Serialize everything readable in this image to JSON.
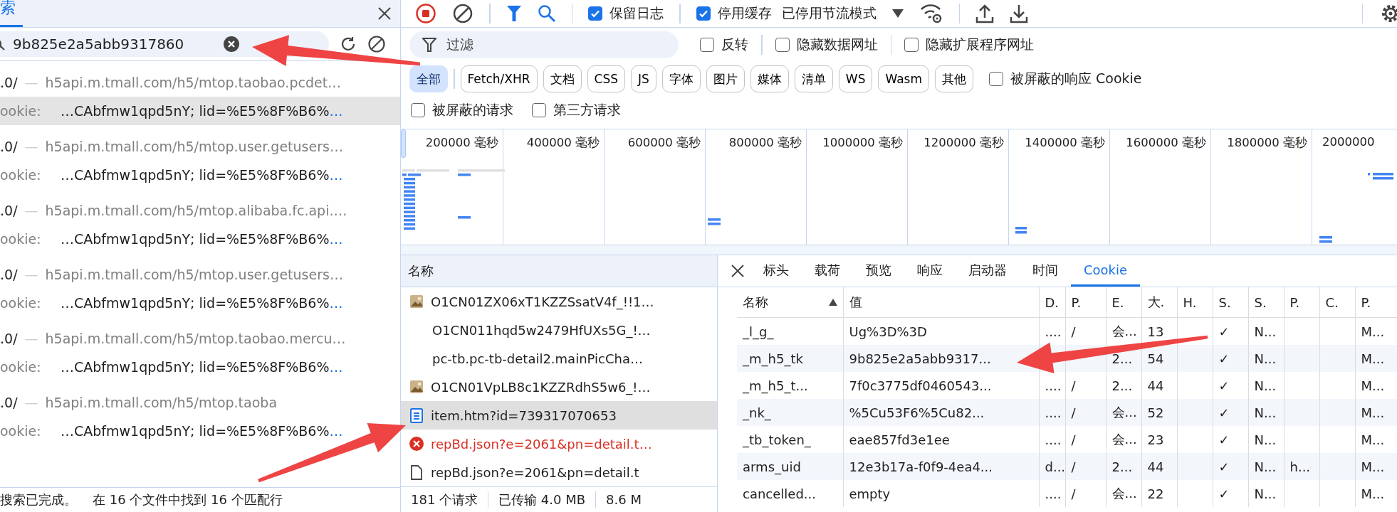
{
  "search_panel": {
    "tab": {
      "label": "索",
      "selected": true
    },
    "query": "9b825e2a5abb9317860",
    "results": [
      {
        "file": ".0/",
        "separator": "—",
        "url": "h5api.m.tmall.com/h5/mtop.taobao.pcdet…",
        "match_label": "ookie:",
        "match_text": "…CAbfmw1qpd5nY; lid=%E5%8F%B6%",
        "more": "…",
        "selected": true
      },
      {
        "file": ".0/",
        "separator": "—",
        "url": "h5api.m.tmall.com/h5/mtop.user.getusers…",
        "match_label": "ookie:",
        "match_text": "…CAbfmw1qpd5nY; lid=%E5%8F%B6%",
        "more": "…",
        "selected": false
      },
      {
        "file": ".0/",
        "separator": "—",
        "url": "h5api.m.tmall.com/h5/mtop.alibaba.fc.api.…",
        "match_label": "ookie:",
        "match_text": "…CAbfmw1qpd5nY; lid=%E5%8F%B6%",
        "more": "…",
        "selected": false
      },
      {
        "file": ".0/",
        "separator": "—",
        "url": "h5api.m.tmall.com/h5/mtop.user.getusers…",
        "match_label": "ookie:",
        "match_text": "…CAbfmw1qpd5nY; lid=%E5%8F%B6%",
        "more": "…",
        "selected": false
      },
      {
        "file": ".0/",
        "separator": "—",
        "url": "h5api.m.tmall.com/h5/mtop.taobao.mercu…",
        "match_label": "ookie:",
        "match_text": "…CAbfmw1qpd5nY; lid=%E5%8F%B6%",
        "more": "…",
        "selected": false
      },
      {
        "file": ".0/",
        "separator": "—",
        "url": "h5api.m.tmall.com/h5/mtop.taoba",
        "match_label": "ookie:",
        "match_text": "…CAbfmw1qpd5nY; lid=%E5%8F%B6%",
        "more": "…",
        "selected": false
      }
    ],
    "status": [
      "搜索已完成。",
      "在 16 个文件中找到 16 个匹配行"
    ]
  },
  "toolbar": {
    "recording": true,
    "filter_shown": true,
    "checkboxes": [
      {
        "label": "保留日志",
        "checked": true
      },
      {
        "label": "停用缓存",
        "checked": true
      }
    ],
    "throttling": "已停用节流模式"
  },
  "filters": {
    "placeholder": "过滤",
    "options": [
      {
        "label": "反转",
        "checked": false
      },
      {
        "label": "隐藏数据网址",
        "checked": false
      },
      {
        "label": "隐藏扩展程序网址",
        "checked": false
      }
    ],
    "types": [
      {
        "label": "全部",
        "selected": true
      },
      {
        "label": "Fetch/XHR",
        "selected": false
      },
      {
        "label": "文档",
        "selected": false
      },
      {
        "label": "CSS",
        "selected": false
      },
      {
        "label": "JS",
        "selected": false
      },
      {
        "label": "字体",
        "selected": false
      },
      {
        "label": "图片",
        "selected": false
      },
      {
        "label": "媒体",
        "selected": false
      },
      {
        "label": "清单",
        "selected": false
      },
      {
        "label": "WS",
        "selected": false
      },
      {
        "label": "Wasm",
        "selected": false
      },
      {
        "label": "其他",
        "selected": false
      }
    ],
    "blocked_cookies": {
      "label": "被屏蔽的响应 Cookie",
      "checked": false
    },
    "more_options": [
      {
        "label": "被屏蔽的请求",
        "checked": false
      },
      {
        "label": "第三方请求",
        "checked": false
      }
    ]
  },
  "overview": {
    "ticks": [
      "200000 毫秒",
      "400000 毫秒",
      "600000 毫秒",
      "800000 毫秒",
      "1000000 毫秒",
      "1200000 毫秒",
      "1400000 毫秒",
      "1600000 毫秒",
      "1800000 毫秒",
      "2000000"
    ]
  },
  "requests": {
    "header": "名称",
    "rows": [
      {
        "name": "O1CN01ZX06xT1KZZSsatV4f_!!1…",
        "kind": "image",
        "selected": false
      },
      {
        "name": "O1CN011hqd5w2479HfUXs5G_!…",
        "kind": "plain",
        "selected": false
      },
      {
        "name": "pc-tb.pc-tb-detail2.mainPicCha…",
        "kind": "plain",
        "selected": false
      },
      {
        "name": "O1CN01VpLB8c1KZZRdhS5w6_!…",
        "kind": "image",
        "selected": false
      },
      {
        "name": "item.htm?id=739317070653",
        "kind": "document",
        "selected": true
      },
      {
        "name": "repBd.json?e=2061&pn=detail.t…",
        "kind": "error",
        "selected": false
      },
      {
        "name": "repBd.json?e=2061&pn=detail.t",
        "kind": "file",
        "selected": false
      }
    ],
    "status": [
      "181 个请求",
      "已传输 4.0 MB",
      "8.6 M"
    ]
  },
  "details": {
    "tabs": [
      {
        "label": "标头",
        "selected": false
      },
      {
        "label": "载荷",
        "selected": false
      },
      {
        "label": "预览",
        "selected": false
      },
      {
        "label": "响应",
        "selected": false
      },
      {
        "label": "启动器",
        "selected": false
      },
      {
        "label": "时间",
        "selected": false
      },
      {
        "label": "Cookie",
        "selected": true
      }
    ],
    "cookies": {
      "columns": [
        {
          "label": "名称",
          "sorted": true
        },
        {
          "label": "值",
          "sorted": false
        },
        {
          "label": "D.",
          "sorted": false
        },
        {
          "label": "P.",
          "sorted": false
        },
        {
          "label": "E.",
          "sorted": false
        },
        {
          "label": "大.",
          "sorted": false
        },
        {
          "label": "H.",
          "sorted": false
        },
        {
          "label": "S.",
          "sorted": false
        },
        {
          "label": "S.",
          "sorted": false
        },
        {
          "label": "P.",
          "sorted": false
        },
        {
          "label": "C.",
          "sorted": false
        },
        {
          "label": "P.",
          "sorted": false
        }
      ],
      "rows": [
        {
          "cells": [
            "_l_g_",
            "Ug%3D%3D",
            "....",
            "/",
            "会...",
            "13",
            null,
            "✓",
            "N...",
            null,
            null,
            "M..."
          ]
        },
        {
          "cells": [
            "_m_h5_tk",
            "9b825e2a5abb9317...",
            null,
            null,
            "2...",
            "54",
            null,
            "✓",
            "N...",
            null,
            null,
            "M..."
          ]
        },
        {
          "cells": [
            "_m_h5_t...",
            "7f0c3775df0460543...",
            "....",
            "/",
            "2...",
            "44",
            null,
            "✓",
            "N...",
            null,
            null,
            "M..."
          ]
        },
        {
          "cells": [
            "_nk_",
            "%5Cu53F6%5Cu82...",
            "....",
            "/",
            "会...",
            "52",
            null,
            "✓",
            "N...",
            null,
            null,
            "M..."
          ]
        },
        {
          "cells": [
            "_tb_token_",
            "eae857fd3e1ee",
            "....",
            "/",
            "会...",
            "23",
            null,
            "✓",
            "N...",
            null,
            null,
            "M..."
          ]
        },
        {
          "cells": [
            "arms_uid",
            "12e3b17a-f0f9-4ea4...",
            "d...",
            "/",
            "2...",
            "44",
            null,
            "✓",
            "N...",
            "h...",
            null,
            "M..."
          ]
        },
        {
          "cells": [
            "cancelled...",
            "empty",
            "....",
            "/",
            "会...",
            "22",
            null,
            "✓",
            "N...",
            null,
            null,
            "M..."
          ]
        }
      ]
    }
  }
}
